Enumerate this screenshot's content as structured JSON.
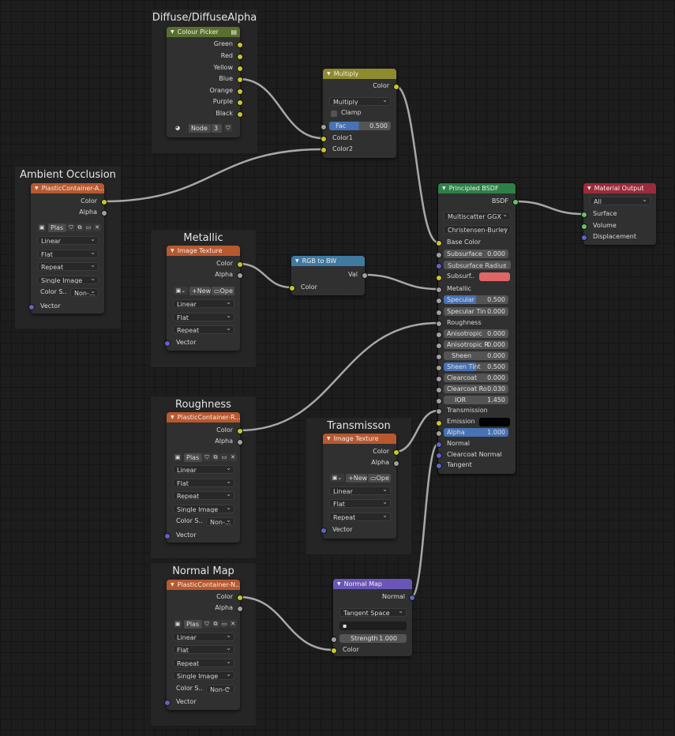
{
  "frames": {
    "diffuse": "Diffuse/DiffuseAlpha",
    "ambient": "Ambient Occlusion",
    "metallic": "Metallic",
    "roughness": "Roughness",
    "transmission": "Transmisson",
    "normal_map": "Normal Map"
  },
  "colour_picker": {
    "title": "Colour Picker",
    "outputs": [
      "Green",
      "Red",
      "Yellow",
      "Blue",
      "Orange",
      "Purple",
      "Black"
    ],
    "node_label": "Node",
    "node_value": "3"
  },
  "multiply": {
    "title": "Multiply",
    "output": "Color",
    "blend_mode": "Multiply",
    "clamp_label": "Clamp",
    "fac_label": "Fac",
    "fac_value": "0.500",
    "fac_fraction": 0.5,
    "input1": "Color1",
    "input2": "Color2"
  },
  "ao_texture": {
    "title": "PlasticContainer-A...",
    "out_color": "Color",
    "out_alpha": "Alpha",
    "image_name": "Plas",
    "interpolation": "Linear",
    "projection": "Flat",
    "extension": "Repeat",
    "source": "Single Image",
    "colorspace_label": "Color S..",
    "colorspace_value": "Non-...",
    "vector": "Vector"
  },
  "metallic_texture": {
    "title": "Image Texture",
    "out_color": "Color",
    "out_alpha": "Alpha",
    "new_label": "New",
    "open_label": "Ope",
    "interpolation": "Linear",
    "projection": "Flat",
    "extension": "Repeat",
    "vector": "Vector"
  },
  "rgb_to_bw": {
    "title": "RGB to BW",
    "output": "Val",
    "input": "Color"
  },
  "roughness_texture": {
    "title": "PlasticContainer-R...",
    "out_color": "Color",
    "out_alpha": "Alpha",
    "image_name": "Plas",
    "interpolation": "Linear",
    "projection": "Flat",
    "extension": "Repeat",
    "source": "Single Image",
    "colorspace_label": "Color S..",
    "colorspace_value": "Non-...",
    "vector": "Vector"
  },
  "transmission_texture": {
    "title": "Image Texture",
    "out_color": "Color",
    "out_alpha": "Alpha",
    "new_label": "New",
    "open_label": "Ope",
    "interpolation": "Linear",
    "projection": "Flat",
    "extension": "Repeat",
    "vector": "Vector"
  },
  "normal_texture": {
    "title": "PlasticContainer-N...",
    "out_color": "Color",
    "out_alpha": "Alpha",
    "image_name": "Plas",
    "interpolation": "Linear",
    "projection": "Flat",
    "extension": "Repeat",
    "source": "Single Image",
    "colorspace_label": "Color S..",
    "colorspace_value": "Non-C",
    "vector": "Vector"
  },
  "normal_map_node": {
    "title": "Normal Map",
    "output": "Normal",
    "space": "Tangent Space",
    "uv_map": "",
    "strength_label": "Strength",
    "strength_value": "1.000",
    "input": "Color"
  },
  "bsdf": {
    "title": "Principled BSDF",
    "output": "BSDF",
    "distribution": "Multiscatter GGX",
    "subsurface_method": "Christensen-Burley",
    "base_color": "Base Color",
    "subsurface": {
      "label": "Subsurface",
      "value": "0.000"
    },
    "subsurface_radius": "Subsurface Radius",
    "subsurface_color": "Subsurf..",
    "metallic": "Metallic",
    "specular": {
      "label": "Specular",
      "value": "0.500",
      "fraction": 0.5
    },
    "specular_tint": {
      "label": "Specular Tin",
      "value": "0.000"
    },
    "roughness": "Roughness",
    "anisotropic": {
      "label": "Anisotropic",
      "value": "0.000"
    },
    "anisotropic_rot": {
      "label": "Anisotropic R",
      "value": "0.000"
    },
    "sheen": {
      "label": "Sheen",
      "value": "0.000"
    },
    "sheen_tint": {
      "label": "Sheen Tint",
      "value": "0.500",
      "fraction": 0.5
    },
    "clearcoat": {
      "label": "Clearcoat",
      "value": "0.000"
    },
    "clearcoat_rough": {
      "label": "Clearcoat Ro",
      "value": "0.030"
    },
    "ior": {
      "label": "IOR",
      "value": "1.450"
    },
    "transmission": "Transmission",
    "emission": "Emission",
    "alpha": {
      "label": "Alpha",
      "value": "1.000",
      "fraction": 1.0
    },
    "normal": "Normal",
    "clearcoat_normal": "Clearcoat Normal",
    "tangent": "Tangent"
  },
  "material_output": {
    "title": "Material Output",
    "target": "All",
    "surface": "Surface",
    "volume": "Volume",
    "displacement": "Displacement"
  },
  "colors": {
    "texture_header": "#b8582f",
    "shader_header": "#2f8047",
    "output_header": "#9b2b39",
    "converter_header": "#3f7aa1",
    "mix_header": "#8e8a2e",
    "vector_header": "#6a55b8",
    "input_header": "#5a6e2f",
    "link": "#a8a8a8",
    "subsurface_color": "#e06666",
    "emission_color": "#000000"
  }
}
